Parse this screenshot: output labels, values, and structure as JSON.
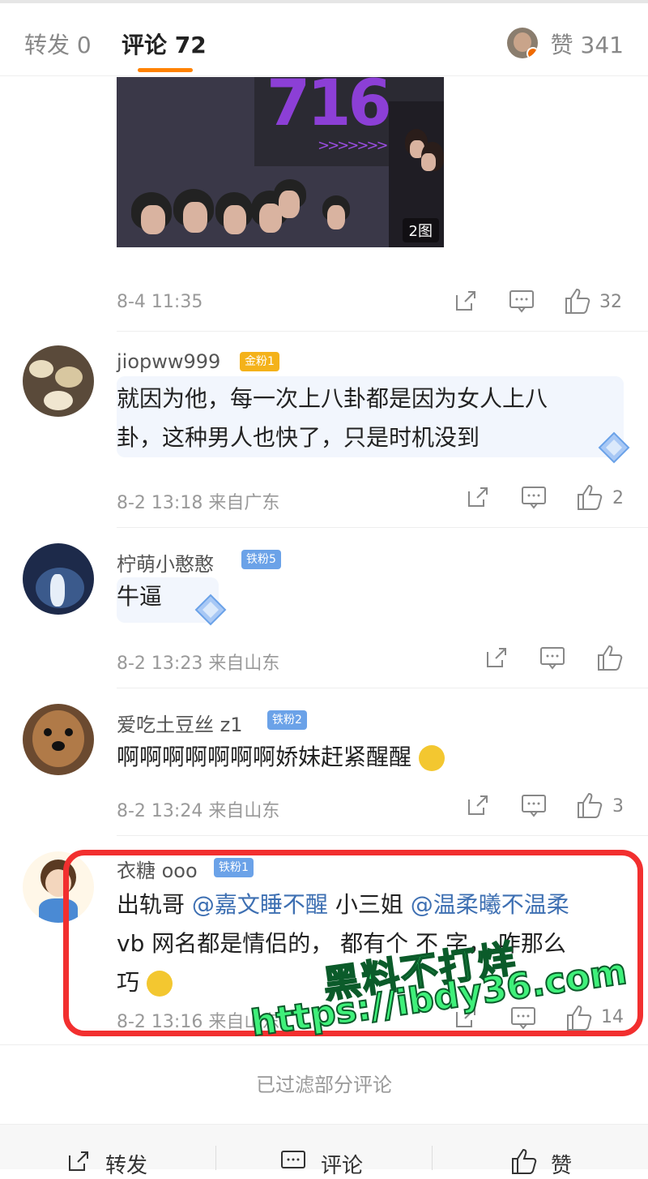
{
  "tabs": {
    "repost": "转发 0",
    "comment": "评论 72",
    "like": "赞 341"
  },
  "post": {
    "image_badge": "2图",
    "time": "8-4 11:35",
    "like_count": "32"
  },
  "comments": [
    {
      "name": "jiopww999",
      "fan": "金粉1",
      "text_line1": "就因为他，每一次上八卦都是因为女人上八",
      "text_line2": "卦，这种男人也快了，只是时机没到",
      "time": "8-2 13:18 来自广东",
      "likes": "2"
    },
    {
      "name": "柠萌小憨憨",
      "fan": "铁粉5",
      "text": "牛逼",
      "time": "8-2 13:23 来自山东",
      "likes": ""
    },
    {
      "name": "爱吃土豆丝 z1",
      "fan": "铁粉2",
      "text": "啊啊啊啊啊啊啊娇妹赶紧醒醒",
      "time": "8-2 13:24 来自山东",
      "likes": "3"
    },
    {
      "name": "衣糖 ooo",
      "fan": "铁粉1",
      "text_a": "出轨哥 ",
      "mention1": "@嘉文睡不醒",
      "text_b": " 小三姐 ",
      "mention2": "@温柔曦不温柔",
      "text_line2": "vb 网名都是情侣的， 都有个 不 字， 咋那么",
      "text_line3": "巧",
      "time": "8-2 13:16 来自山东",
      "likes": "14"
    }
  ],
  "watermark": {
    "line1": "黑料不打烊",
    "line2": "https://ibdy36.com"
  },
  "filtered_notice": "已过滤部分评论",
  "bottom_bar": {
    "repost": "转发",
    "comment": "评论",
    "like": "赞"
  },
  "colors": {
    "accent": "#ff8200",
    "mention": "#3d6fb2",
    "highlight_box": "#f22f2f",
    "watermark": "#3ff07a"
  }
}
